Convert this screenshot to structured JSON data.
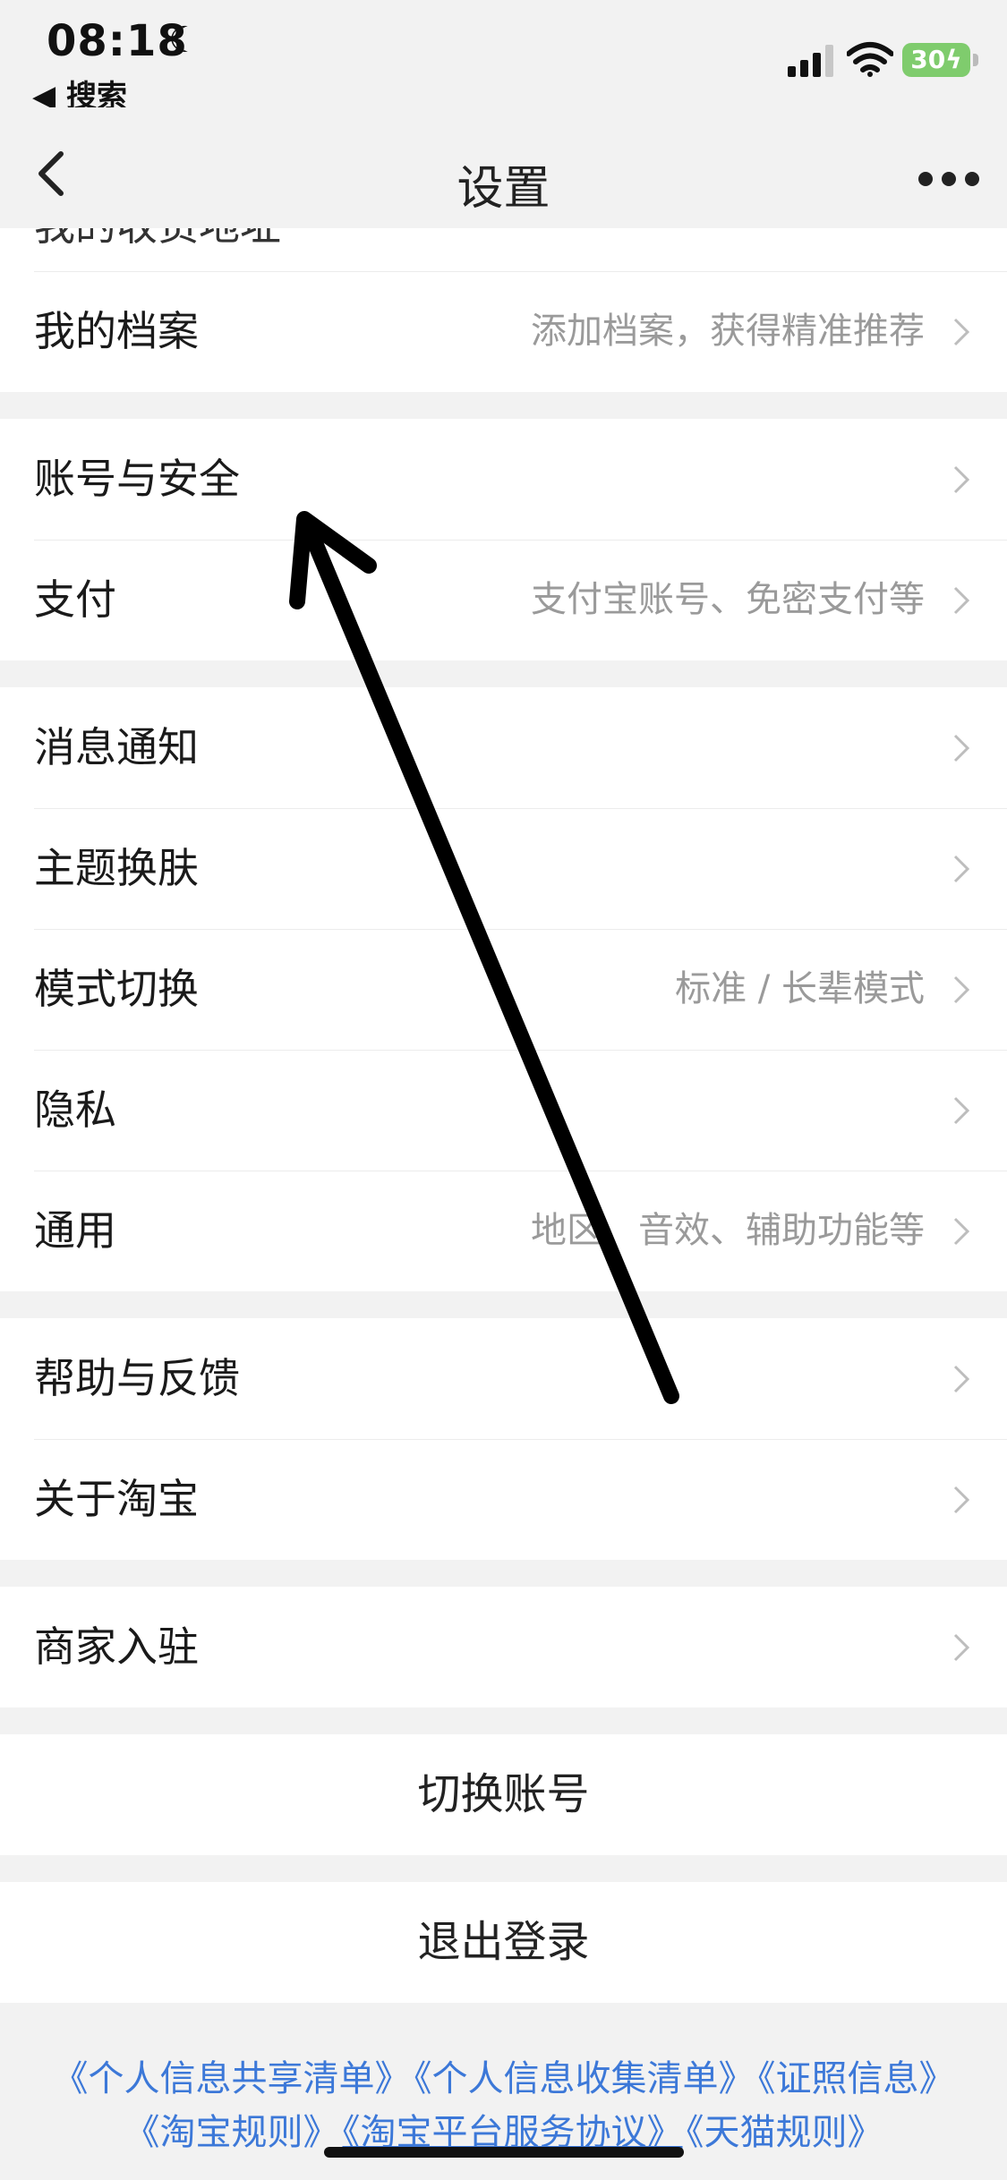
{
  "status_bar": {
    "time": "08:18",
    "back_app": "◀ 搜索",
    "battery": "30"
  },
  "nav": {
    "title": "设置"
  },
  "groups": {
    "g1": {
      "partial_label": "我的收货地址",
      "archive": {
        "label": "我的档案",
        "value": "添加档案，获得精准推荐"
      }
    },
    "g2": {
      "account": {
        "label": "账号与安全",
        "value": ""
      },
      "pay": {
        "label": "支付",
        "value": "支付宝账号、免密支付等"
      }
    },
    "g3": {
      "notify": {
        "label": "消息通知",
        "value": ""
      },
      "theme": {
        "label": "主题换肤",
        "value": ""
      },
      "mode": {
        "label": "模式切换",
        "value": "标准 / 长辈模式"
      },
      "privacy": {
        "label": "隐私",
        "value": ""
      },
      "general": {
        "label": "通用",
        "value": "地区、音效、辅助功能等"
      }
    },
    "g4": {
      "help": {
        "label": "帮助与反馈",
        "value": ""
      },
      "about": {
        "label": "关于淘宝",
        "value": ""
      }
    },
    "g5": {
      "merchant": {
        "label": "商家入驻",
        "value": ""
      }
    }
  },
  "actions": {
    "switch_account": "切换账号",
    "logout": "退出登录"
  },
  "footer": {
    "line1": [
      "《个人信息共享清单》",
      "《个人信息收集清单》",
      "《证照信息》"
    ],
    "line2": [
      "《淘宝规则》",
      "《淘宝平台服务协议》",
      "《天猫规则》"
    ]
  },
  "colors": {
    "link": "#3c78d8",
    "battery": "#7fcc6d",
    "background": "#f2f2f2"
  }
}
